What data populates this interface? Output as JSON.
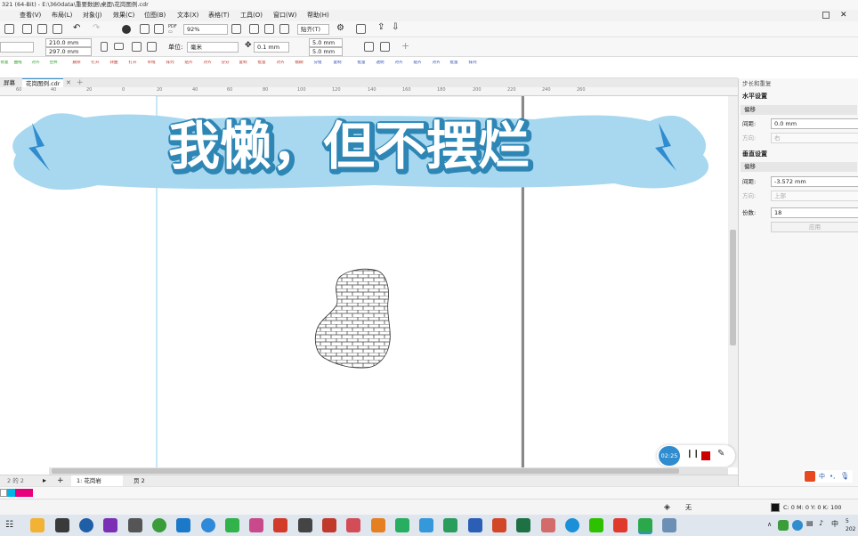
{
  "window": {
    "title": "321 (64-Bit) - E:\\360data\\重要数据\\桌面\\花岗图例.cdr"
  },
  "menu": [
    "查看(V)",
    "布局(L)",
    "对象(J)",
    "效果(C)",
    "位图(B)",
    "文本(X)",
    "表格(T)",
    "工具(O)",
    "窗口(W)",
    "帮助(H)"
  ],
  "toolbar1": {
    "zoom": "92%",
    "snap_label": "贴齐(T)"
  },
  "toolbar2": {
    "width": "210.0 mm",
    "height": "297.0 mm",
    "units_label": "单位:",
    "units_value": "毫米",
    "nudge": "0.1 mm",
    "dup_x": "5.0 mm",
    "dup_y": "5.0 mm"
  },
  "toolbar3": {
    "labels": [
      "修复",
      "曲线",
      "对齐",
      "合并",
      "删除",
      "打开",
      "转曲",
      "打开",
      "单线",
      "排列",
      "贴齐",
      "对齐",
      "分分",
      "复制",
      "批量",
      "对齐",
      "模糊",
      "分组",
      "复制",
      "批量",
      "透明",
      "对齐",
      "贴齐",
      "对齐",
      "批量",
      "排列"
    ]
  },
  "doctabs": [
    "屏幕",
    "花岗图例.cdr"
  ],
  "ruler": [
    "60",
    "40",
    "20",
    "0",
    "20",
    "40",
    "60",
    "80",
    "100",
    "120",
    "140",
    "160",
    "180",
    "200",
    "220",
    "240",
    "260"
  ],
  "banner": {
    "text": "我懒，但不摆烂"
  },
  "recorder": {
    "time": "02:25"
  },
  "pages": {
    "counter": "2 的 2",
    "page1": "1: 花岗岩",
    "page2": "页 2"
  },
  "status": {
    "fill": "无",
    "cmyk": "C: 0 M: 0 Y: 0 K: 100"
  },
  "docker": {
    "title": "步长和重复",
    "horizontal": {
      "header": "水平设置",
      "band": "偏移",
      "distance_label": "间距:",
      "distance_value": "0.0 mm",
      "direction_label": "方向:",
      "direction_value": "右"
    },
    "vertical": {
      "header": "垂直设置",
      "band": "偏移",
      "distance_label": "间距:",
      "distance_value": "-3.572 mm",
      "direction_label": "方向:",
      "direction_value": "上部"
    },
    "copies_label": "份数:",
    "copies_value": "18",
    "apply_label": "应用"
  },
  "ime": {
    "label": "中"
  },
  "clock": {
    "line1": "5",
    "line2": "202"
  },
  "colors": {
    "banner_fill": "#a8d8ef",
    "banner_text": "#ffffff",
    "banner_shadow": "#2e86b5",
    "accent_blue": "#2f8ccf"
  }
}
